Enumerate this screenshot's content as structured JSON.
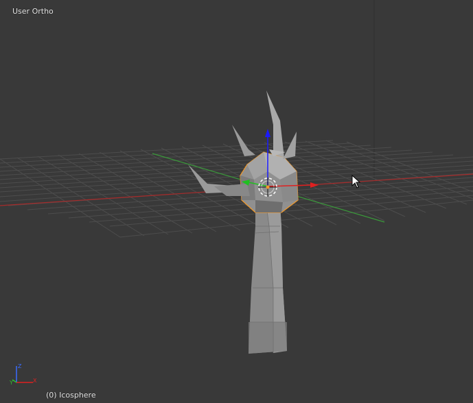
{
  "viewport": {
    "view_label": "User Ortho",
    "active_object_label": "(0) Icosphere",
    "colors": {
      "background": "#393939",
      "grid": "#505050",
      "x_axis": "#a82a2a",
      "y_axis": "#3a9a3a",
      "selection_outline": "#f39a2a",
      "mesh": "#8c8c8c"
    }
  },
  "gizmo": {
    "x_label": "X",
    "y_label": "Y",
    "z_label": "Z"
  }
}
